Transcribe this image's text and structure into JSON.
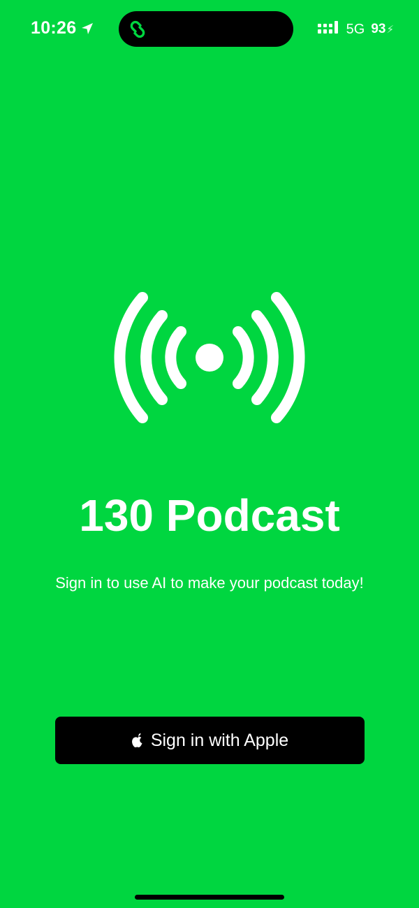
{
  "status_bar": {
    "time": "10:26",
    "network": "5G",
    "battery": "93"
  },
  "main": {
    "title": "130 Podcast",
    "subtitle": "Sign in to use AI to make your podcast today!",
    "sign_in_button_label": "Sign in with Apple"
  },
  "icons": {
    "location": "location-arrow-icon",
    "island_app": "link-icon",
    "signal": "cellular-signal-icon",
    "battery": "battery-charging-icon",
    "logo": "broadcast-icon",
    "apple": "apple-logo-icon"
  },
  "colors": {
    "background": "#00d640",
    "foreground": "#ffffff",
    "button_background": "#000000"
  }
}
